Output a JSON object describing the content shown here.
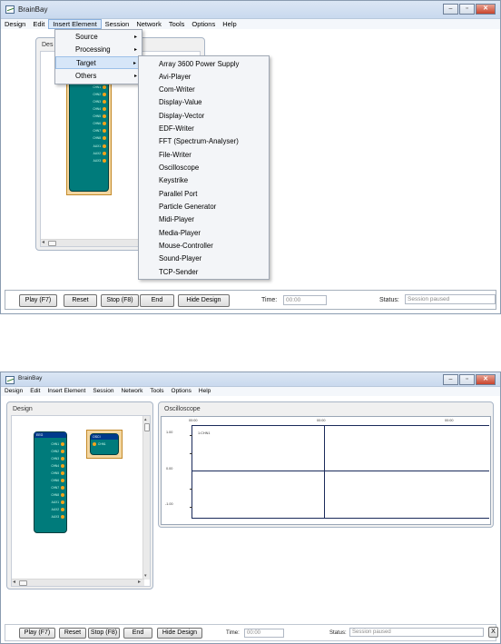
{
  "app": {
    "title": "BrainBay"
  },
  "menubar": [
    "Design",
    "Edit",
    "Insert Element",
    "Session",
    "Network",
    "Tools",
    "Options",
    "Help"
  ],
  "insert_menu": [
    {
      "label": "Source",
      "has_submenu": true
    },
    {
      "label": "Processing",
      "has_submenu": true
    },
    {
      "label": "Target",
      "has_submenu": true,
      "highlighted": true
    },
    {
      "label": "Others",
      "has_submenu": true
    }
  ],
  "target_submenu": [
    "Array 3600 Power Supply",
    "Avi-Player",
    "Com-Writer",
    "Display-Value",
    "Display-Vector",
    "EDF-Writer",
    "FFT (Spectrum-Analyser)",
    "File-Writer",
    "Oscilloscope",
    "Keystrike",
    "Parallel Port",
    "Particle Generator",
    "Midi-Player",
    "Media-Player",
    "Mouse-Controller",
    "Sound-Player",
    "TCP-Sender"
  ],
  "design_panel": {
    "title": "Design",
    "title_truncated": "Des"
  },
  "eeg_module": {
    "title": "EEG",
    "ports": [
      "CHN1",
      "CHN2",
      "CHN3",
      "CHN4",
      "CHN5",
      "CHN6",
      "CHN7",
      "CHN8",
      "AUX1",
      "AUX2",
      "AUX3"
    ]
  },
  "osci_module": {
    "title": "OSCI",
    "port": "CHN1"
  },
  "oscilloscope": {
    "title": "Oscilloscope",
    "time_labels": [
      "00:00",
      "00:00",
      "00:00"
    ],
    "y_labels": [
      "1.00",
      "0.00",
      "-1.00"
    ],
    "trace_label": "1:CHN1"
  },
  "statusbar": {
    "play": "Play (F7)",
    "reset": "Reset",
    "stop": "Stop (F8)",
    "end": "End",
    "hide_design": "Hide Design",
    "time_label": "Time:",
    "time_value": "00:00",
    "status_label": "Status:",
    "status_value": "Session paused",
    "close_glyph": "X"
  },
  "icons": {
    "scroll_left": "◂",
    "scroll_right": "▸",
    "scroll_up": "▴",
    "scroll_down": "▾",
    "submenu_arrow": "▸"
  },
  "colors": {
    "module_teal": "#007b7b",
    "module_header": "#003a8c",
    "port_dot": "#f3a31a"
  }
}
